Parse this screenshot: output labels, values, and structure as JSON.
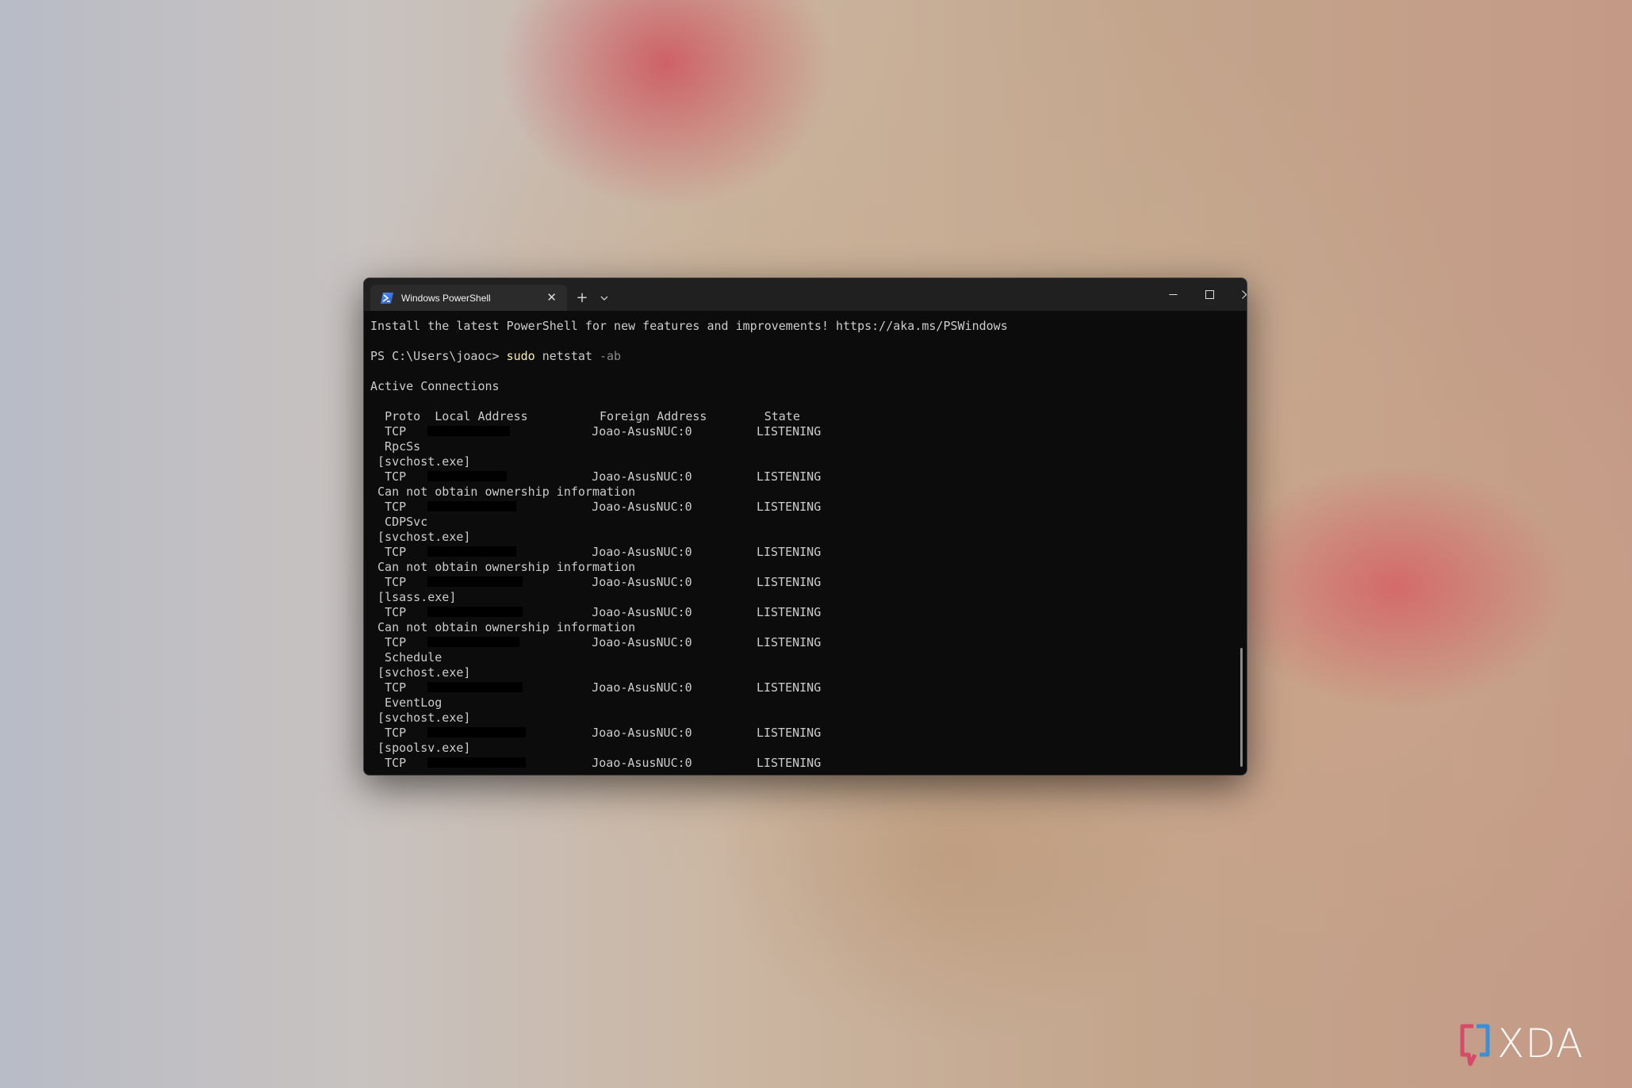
{
  "window": {
    "tab_title": "Windows PowerShell",
    "tab_close_glyph": "✕",
    "new_tab_glyph": "+",
    "icons": {
      "tab": "powershell-icon",
      "dropdown": "chevron-down-icon",
      "minimize": "minimize-icon",
      "maximize": "maximize-icon",
      "close": "close-icon"
    }
  },
  "terminal": {
    "banner": "Install the latest PowerShell for new features and improvements! https://aka.ms/PSWindows",
    "prompt": "PS C:\\Users\\joaoc> ",
    "command": "sudo",
    "command_rest": " netstat ",
    "command_arg": "-ab",
    "section_title": "Active Connections",
    "header": {
      "proto": "Proto",
      "local": "Local Address",
      "foreign": "Foreign Address",
      "state": "State"
    },
    "connections": [
      {
        "proto": "TCP",
        "foreign": "Joao-AsusNUC:0",
        "state": "LISTENING",
        "info": [
          " RpcSs",
          "[svchost.exe]"
        ]
      },
      {
        "proto": "TCP",
        "foreign": "Joao-AsusNUC:0",
        "state": "LISTENING",
        "info": [
          "Can not obtain ownership information"
        ]
      },
      {
        "proto": "TCP",
        "foreign": "Joao-AsusNUC:0",
        "state": "LISTENING",
        "info": [
          " CDPSvc",
          "[svchost.exe]"
        ]
      },
      {
        "proto": "TCP",
        "foreign": "Joao-AsusNUC:0",
        "state": "LISTENING",
        "info": [
          "Can not obtain ownership information"
        ]
      },
      {
        "proto": "TCP",
        "foreign": "Joao-AsusNUC:0",
        "state": "LISTENING",
        "info": [
          "[lsass.exe]"
        ]
      },
      {
        "proto": "TCP",
        "foreign": "Joao-AsusNUC:0",
        "state": "LISTENING",
        "info": [
          "Can not obtain ownership information"
        ]
      },
      {
        "proto": "TCP",
        "foreign": "Joao-AsusNUC:0",
        "state": "LISTENING",
        "info": [
          " Schedule",
          "[svchost.exe]"
        ]
      },
      {
        "proto": "TCP",
        "foreign": "Joao-AsusNUC:0",
        "state": "LISTENING",
        "info": [
          " EventLog",
          "[svchost.exe]"
        ]
      },
      {
        "proto": "TCP",
        "foreign": "Joao-AsusNUC:0",
        "state": "LISTENING",
        "info": [
          "[spoolsv.exe]"
        ]
      },
      {
        "proto": "TCP",
        "foreign": "Joao-AsusNUC:0",
        "state": "LISTENING",
        "info": []
      }
    ]
  },
  "watermark": {
    "text": "XDA",
    "icon": "xda-logo-icon"
  }
}
